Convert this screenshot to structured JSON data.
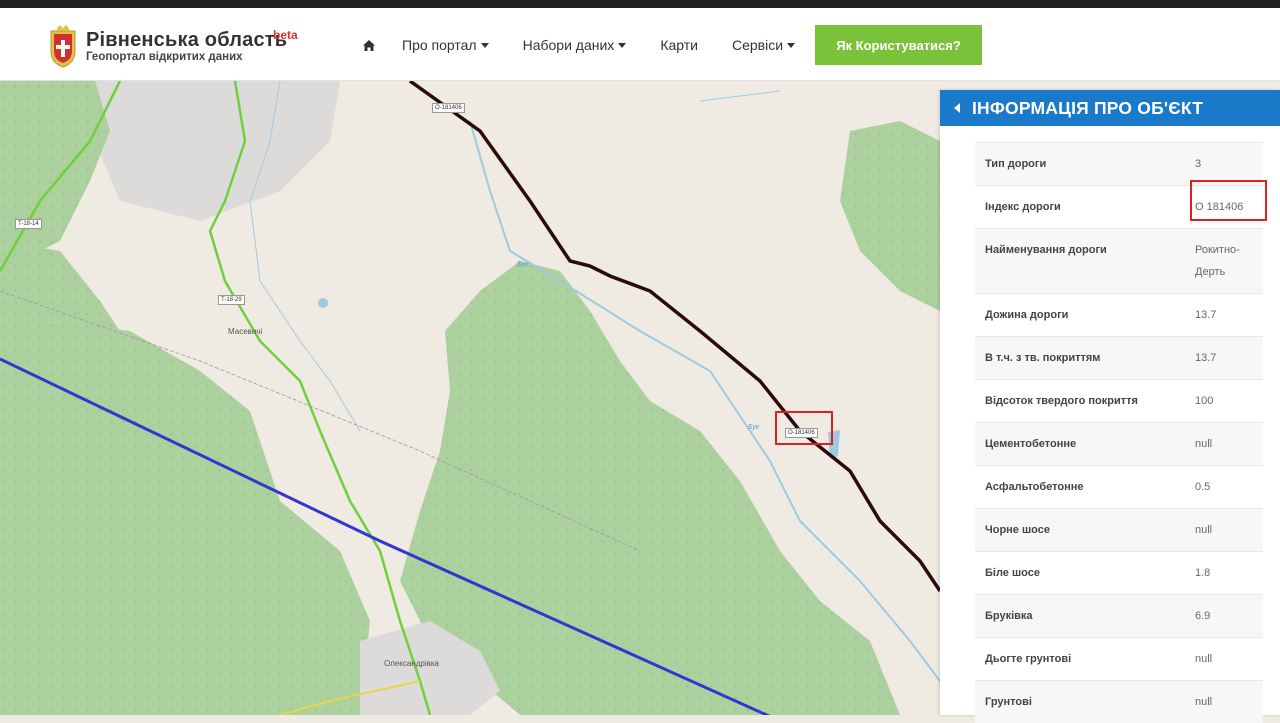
{
  "header": {
    "title": "Рівненська  область",
    "subtitle": "Геопортал відкритих даних",
    "beta": "beta",
    "nav": [
      "Про портал",
      "Набори даних",
      "Карти",
      "Сервіси"
    ],
    "help_button": "Як Користуватися?"
  },
  "map": {
    "labels": [
      "O-181406",
      "T-18-14",
      "T-18-29",
      "O-181406",
      "Бук",
      "Бук"
    ],
    "towns": [
      "Масевичі",
      "Олександрівка"
    ]
  },
  "panel": {
    "title": "ІНФОРМАЦІЯ ПРО ОБ'ЄКТ",
    "rows": [
      {
        "k": "Тип дороги",
        "v": "3"
      },
      {
        "k": "Індекс дороги",
        "v": "O 181406"
      },
      {
        "k": "Найменування дороги",
        "v": "Рокитно-Дерть"
      },
      {
        "k": "Дожина дороги",
        "v": "13.7"
      },
      {
        "k": "В т.ч. з тв. покриттям",
        "v": "13.7"
      },
      {
        "k": "Відсоток твердого покриття",
        "v": "100"
      },
      {
        "k": "Цементобетонне",
        "v": "null"
      },
      {
        "k": "Асфальтобетонне",
        "v": "0.5"
      },
      {
        "k": "Чорне шосе",
        "v": "null"
      },
      {
        "k": "Біле шосе",
        "v": "1.8"
      },
      {
        "k": "Бруківка",
        "v": "6.9"
      },
      {
        "k": "Дьогте грунтові",
        "v": "null"
      },
      {
        "k": "Грунтові",
        "v": "null"
      }
    ]
  },
  "colors": {
    "accent": "#1a79c9",
    "help": "#79c23a",
    "highlight": "#e0201c"
  }
}
